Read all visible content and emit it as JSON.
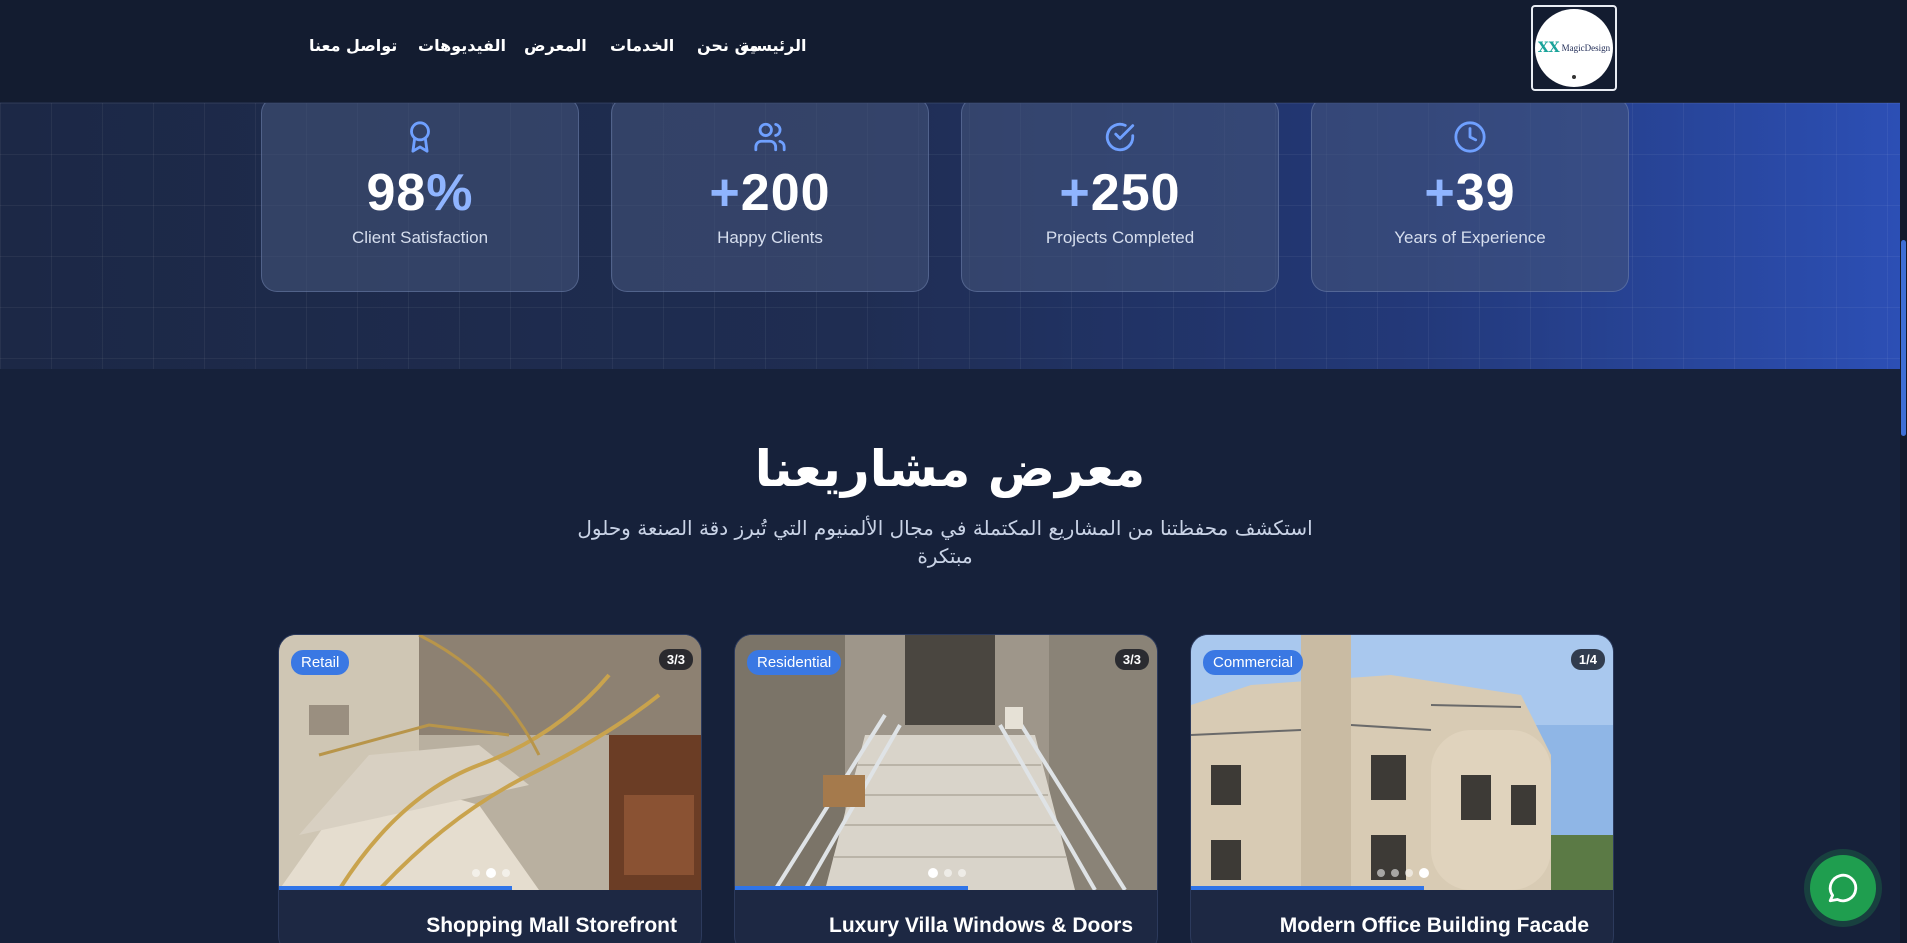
{
  "nav": {
    "items": [
      "الرئيسية",
      "من نحن",
      "الخدمات",
      "المعرض",
      "الفيديوهات",
      "تواصل معنا"
    ]
  },
  "logo": {
    "mark": "XX",
    "text": "MagicDesign"
  },
  "stats": [
    {
      "value": "98",
      "accent": "%",
      "label": "Client Satisfaction",
      "icon": "award-icon"
    },
    {
      "value": "200",
      "accent": "+",
      "label": "Happy Clients",
      "icon": "users-icon"
    },
    {
      "value": "250",
      "accent": "+",
      "label": "Projects Completed",
      "icon": "check-circle-icon"
    },
    {
      "value": "39",
      "accent": "+",
      "label": "Years of Experience",
      "icon": "clock-icon"
    }
  ],
  "portfolio": {
    "title": "معرض مشاريعنا",
    "subtitle": "استكشف محفظتنا من المشاريع المكتملة في مجال الألمنيوم التي تُبرز دقة الصنعة وحلول مبتكرة",
    "projects": [
      {
        "tag": "Retail",
        "count": "3/3",
        "title": "Shopping Mall Storefront",
        "progress": 0.55,
        "slides": 3,
        "active_slide": 1
      },
      {
        "tag": "Residential",
        "count": "3/3",
        "title": "Luxury Villa Windows & Doors",
        "progress": 0.55,
        "slides": 3,
        "active_slide": 1
      },
      {
        "tag": "Commercial",
        "count": "1/4",
        "title": "Modern Office Building Facade",
        "progress": 0.55,
        "slides": 4,
        "active_slide": 4
      }
    ]
  },
  "colors": {
    "accent": "#8fb4ff",
    "tag_blue": "#3a78e3",
    "whatsapp": "#1f9e4f"
  }
}
